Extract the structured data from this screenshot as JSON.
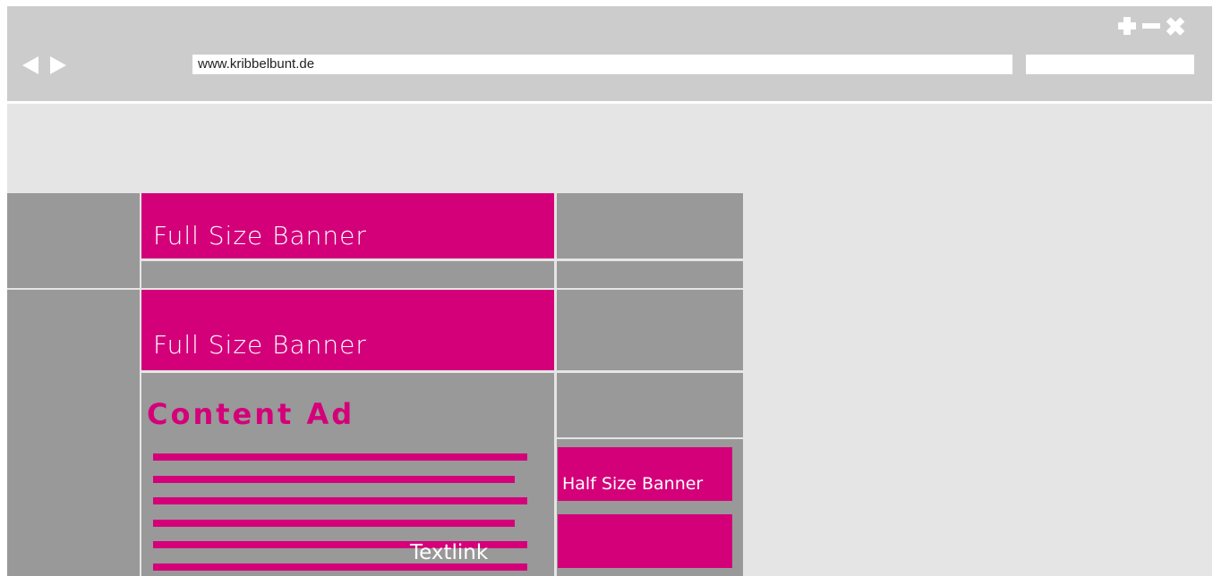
{
  "browser": {
    "url": "www.kribbelbunt.de",
    "search_value": "",
    "icons": {
      "back": "back-arrow-icon",
      "forward": "forward-arrow-icon",
      "new_tab": "plus-icon",
      "minimize": "minimize-icon",
      "close": "close-icon"
    }
  },
  "page": {
    "banner_1": {
      "label": "Full Size Banner"
    },
    "banner_2": {
      "label": "Full Size Banner"
    },
    "content_ad": {
      "title": "Content Ad",
      "link": "Textlink"
    },
    "half_banner": {
      "label": "Half Size Banner"
    }
  },
  "colors": {
    "accent": "#d4007a",
    "placeholder_gray": "#999999",
    "page_background": "#e5e5e5",
    "chrome": "#cccccc"
  }
}
